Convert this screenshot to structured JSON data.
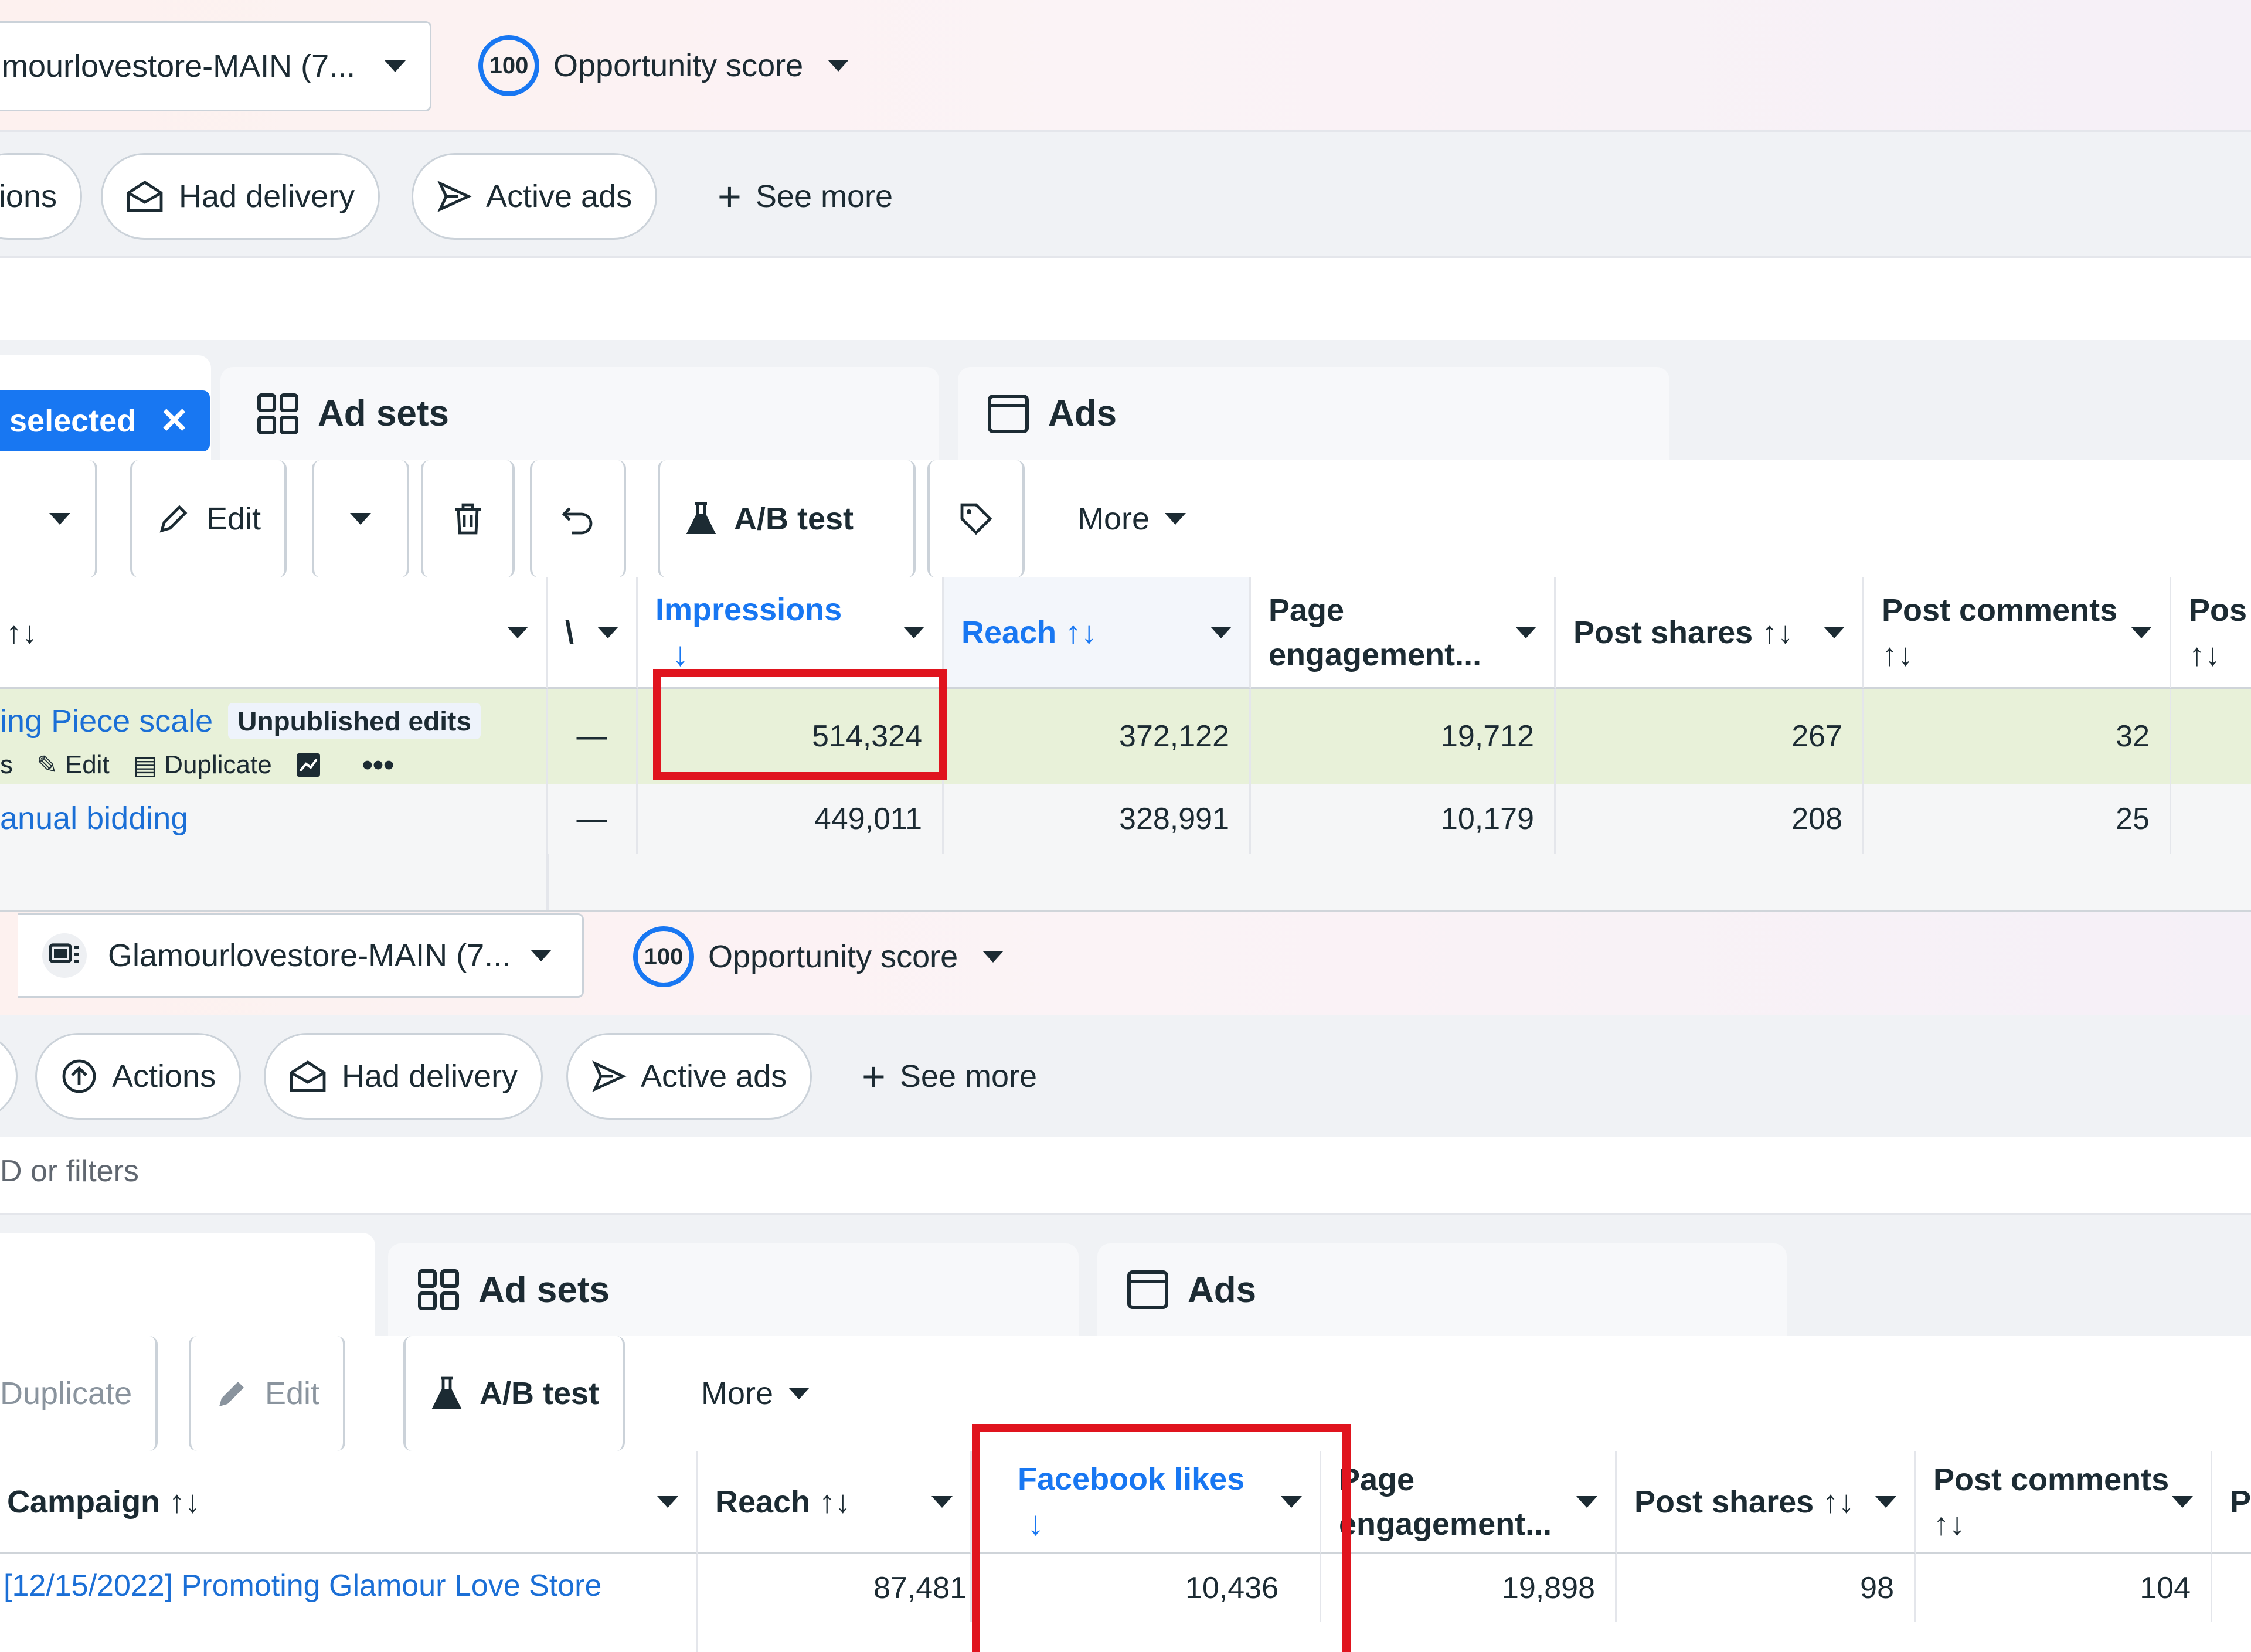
{
  "top": {
    "header": {
      "account_selector": "mourlovestore-MAIN (7...",
      "score": "100",
      "score_label": "Opportunity score"
    },
    "filters": {
      "partial": "ions",
      "had_delivery": "Had delivery",
      "active_ads": "Active ads",
      "see_more": "See more"
    },
    "tabs": {
      "selected_chip": "selected",
      "ad_sets": "Ad sets",
      "ads": "Ads"
    },
    "toolbar": {
      "edit": "Edit",
      "ab_test": "A/B test",
      "more": "More"
    },
    "columns": {
      "name_sort": "↑↓",
      "partial": "\\",
      "impressions": "Impressions",
      "reach": "Reach ↑↓",
      "page_engagement": "Page engagement...",
      "post_shares": "Post shares ↑↓",
      "post_comments": "Post comments ↑↓",
      "pos": "Pos",
      "pos_sort": "↑↓"
    },
    "rows": [
      {
        "name": "ing Piece scale",
        "badge": "Unpublished edits",
        "actions": {
          "partial": "s",
          "edit": "Edit",
          "duplicate": "Duplicate"
        },
        "dash": "—",
        "impressions": "514,324",
        "reach": "372,122",
        "page_engagement": "19,712",
        "post_shares": "267",
        "post_comments": "32"
      },
      {
        "name": "anual bidding",
        "dash": "—",
        "impressions": "449,011",
        "reach": "328,991",
        "page_engagement": "10,179",
        "post_shares": "208",
        "post_comments": "25"
      }
    ]
  },
  "bottom": {
    "header": {
      "account_selector": "Glamourlovestore-MAIN (7...",
      "score": "100",
      "score_label": "Opportunity score"
    },
    "filters": {
      "actions": "Actions",
      "had_delivery": "Had delivery",
      "active_ads": "Active ads",
      "see_more": "See more"
    },
    "search": {
      "placeholder": "D or filters"
    },
    "tabs": {
      "ad_sets": "Ad sets",
      "ads": "Ads"
    },
    "toolbar": {
      "duplicate": "Duplicate",
      "edit": "Edit",
      "ab_test": "A/B test",
      "more": "More"
    },
    "columns": {
      "campaign": "Campaign ↑↓",
      "reach": "Reach ↑↓",
      "facebook_likes": "Facebook likes",
      "page_engagement": "Page engagement...",
      "post_shares": "Post shares ↑↓",
      "post_comments": "Post comments ↑↓",
      "partial": "P"
    },
    "rows": [
      {
        "campaign": "[12/15/2022] Promoting Glamour Love Store",
        "reach": "87,481",
        "facebook_likes": "10,436",
        "page_engagement": "19,898",
        "post_shares": "98",
        "post_comments": "104"
      }
    ]
  },
  "colors": {
    "accent": "#1877f2",
    "highlight_row": "#e8f1d9",
    "annotation": "#e0141e"
  }
}
